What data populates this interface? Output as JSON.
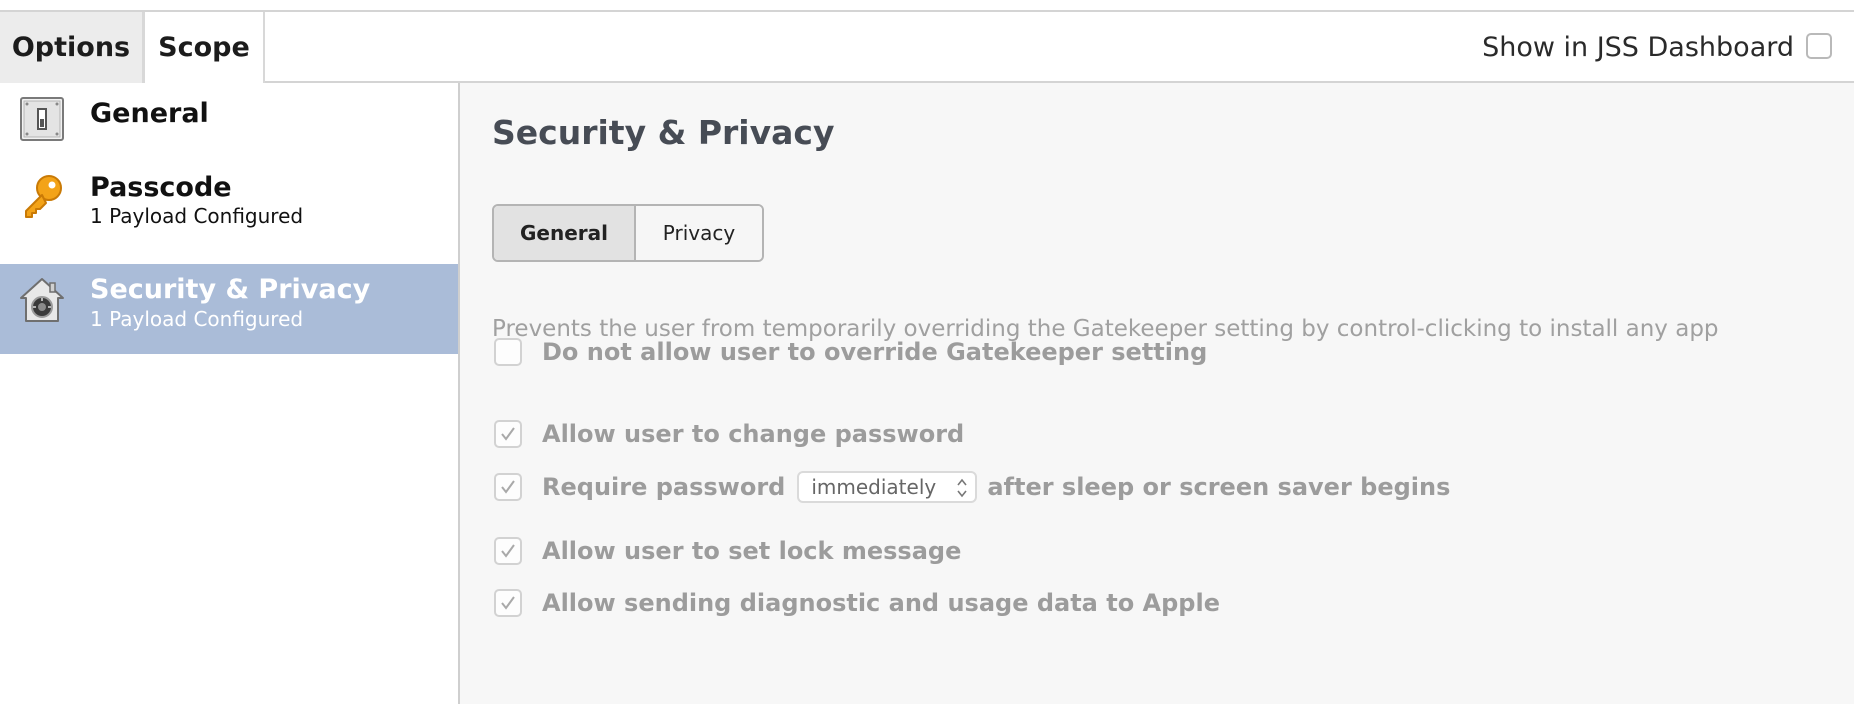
{
  "tabs": {
    "options_label": "Options",
    "scope_label": "Scope"
  },
  "dashboard": {
    "label": "Show in JSS Dashboard",
    "checked": false
  },
  "sidebar": {
    "items": [
      {
        "title": "General",
        "subtitle": "",
        "icon": "switch-icon",
        "selected": false
      },
      {
        "title": "Passcode",
        "subtitle": "1 Payload Configured",
        "icon": "key-icon",
        "selected": false
      },
      {
        "title": "Security & Privacy",
        "subtitle": "1 Payload Configured",
        "icon": "security-house-icon",
        "selected": true
      }
    ]
  },
  "main": {
    "title": "Security & Privacy",
    "segments": {
      "general_label": "General",
      "privacy_label": "Privacy",
      "selected": "General"
    },
    "options": {
      "gatekeeper": {
        "label": "Do not allow user to override Gatekeeper setting",
        "checked": false,
        "description": "Prevents the user from temporarily overriding the Gatekeeper setting by control-clicking to install any app"
      },
      "change_password": {
        "label": "Allow user to change password",
        "checked": true
      },
      "require_password": {
        "label_before": "Require password",
        "select_value": "immediately",
        "label_after": "after sleep or screen saver begins",
        "checked": true
      },
      "lock_message": {
        "label": "Allow user to set lock message",
        "checked": true
      },
      "diagnostics": {
        "label": "Allow sending diagnostic and usage data to Apple",
        "checked": true
      }
    }
  },
  "colors": {
    "selected_row": "#aabcd8",
    "title_text": "#474c55",
    "disabled_text": "#9c9c9c",
    "main_bg": "#f7f7f7"
  }
}
